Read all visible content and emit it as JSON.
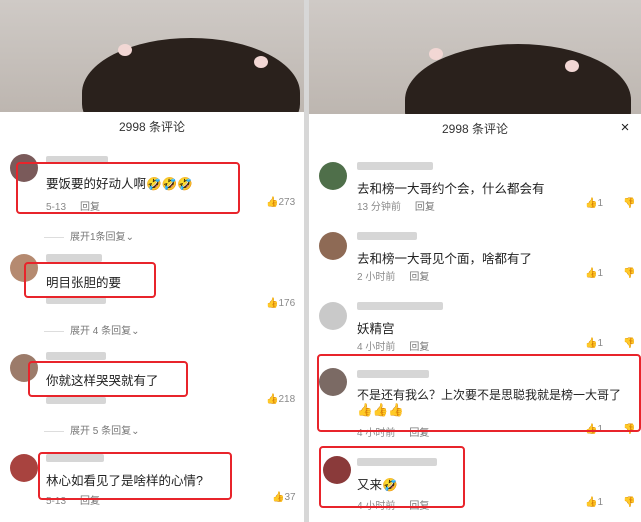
{
  "left": {
    "header": "2998 条评论",
    "comments": [
      {
        "text": "要饭要的好动人啊🤣🤣🤣",
        "date": "5-13",
        "reply": "回复",
        "likes": "273",
        "expand": "展开1条回复"
      },
      {
        "text": "明目张胆的要",
        "date": "",
        "reply": "",
        "likes": "176",
        "expand": "展开 4 条回复"
      },
      {
        "text": "你就这样哭哭就有了",
        "date": "",
        "reply": "",
        "likes": "218",
        "expand": "展开 5 条回复"
      },
      {
        "text": "林心如看见了是啥样的心情?",
        "date": "5-13",
        "reply": "回复",
        "likes": "37",
        "expand": ""
      }
    ]
  },
  "right": {
    "header": "2998 条评论",
    "close": "×",
    "comments": [
      {
        "text": "去和榜一大哥约个会，什么都会有",
        "time": "13 分钟前",
        "reply": "回复",
        "likes": "1"
      },
      {
        "text": "去和榜一大哥见个面，啥都有了",
        "time": "2 小时前",
        "reply": "回复",
        "likes": "1"
      },
      {
        "text": "妖精宫",
        "time": "4 小时前",
        "reply": "回复",
        "likes": "1"
      },
      {
        "text": "不是还有我么？上次要不是思聪我就是榜一大哥了",
        "text2": "👍👍👍",
        "time": "4 小时前",
        "reply": "回复",
        "likes": "1"
      },
      {
        "text": "又来🤣",
        "time": "4 小时前",
        "reply": "回复",
        "likes": "1"
      }
    ]
  },
  "icons": {
    "like": "👍",
    "dislike": "👎",
    "chevron": "⌄"
  }
}
